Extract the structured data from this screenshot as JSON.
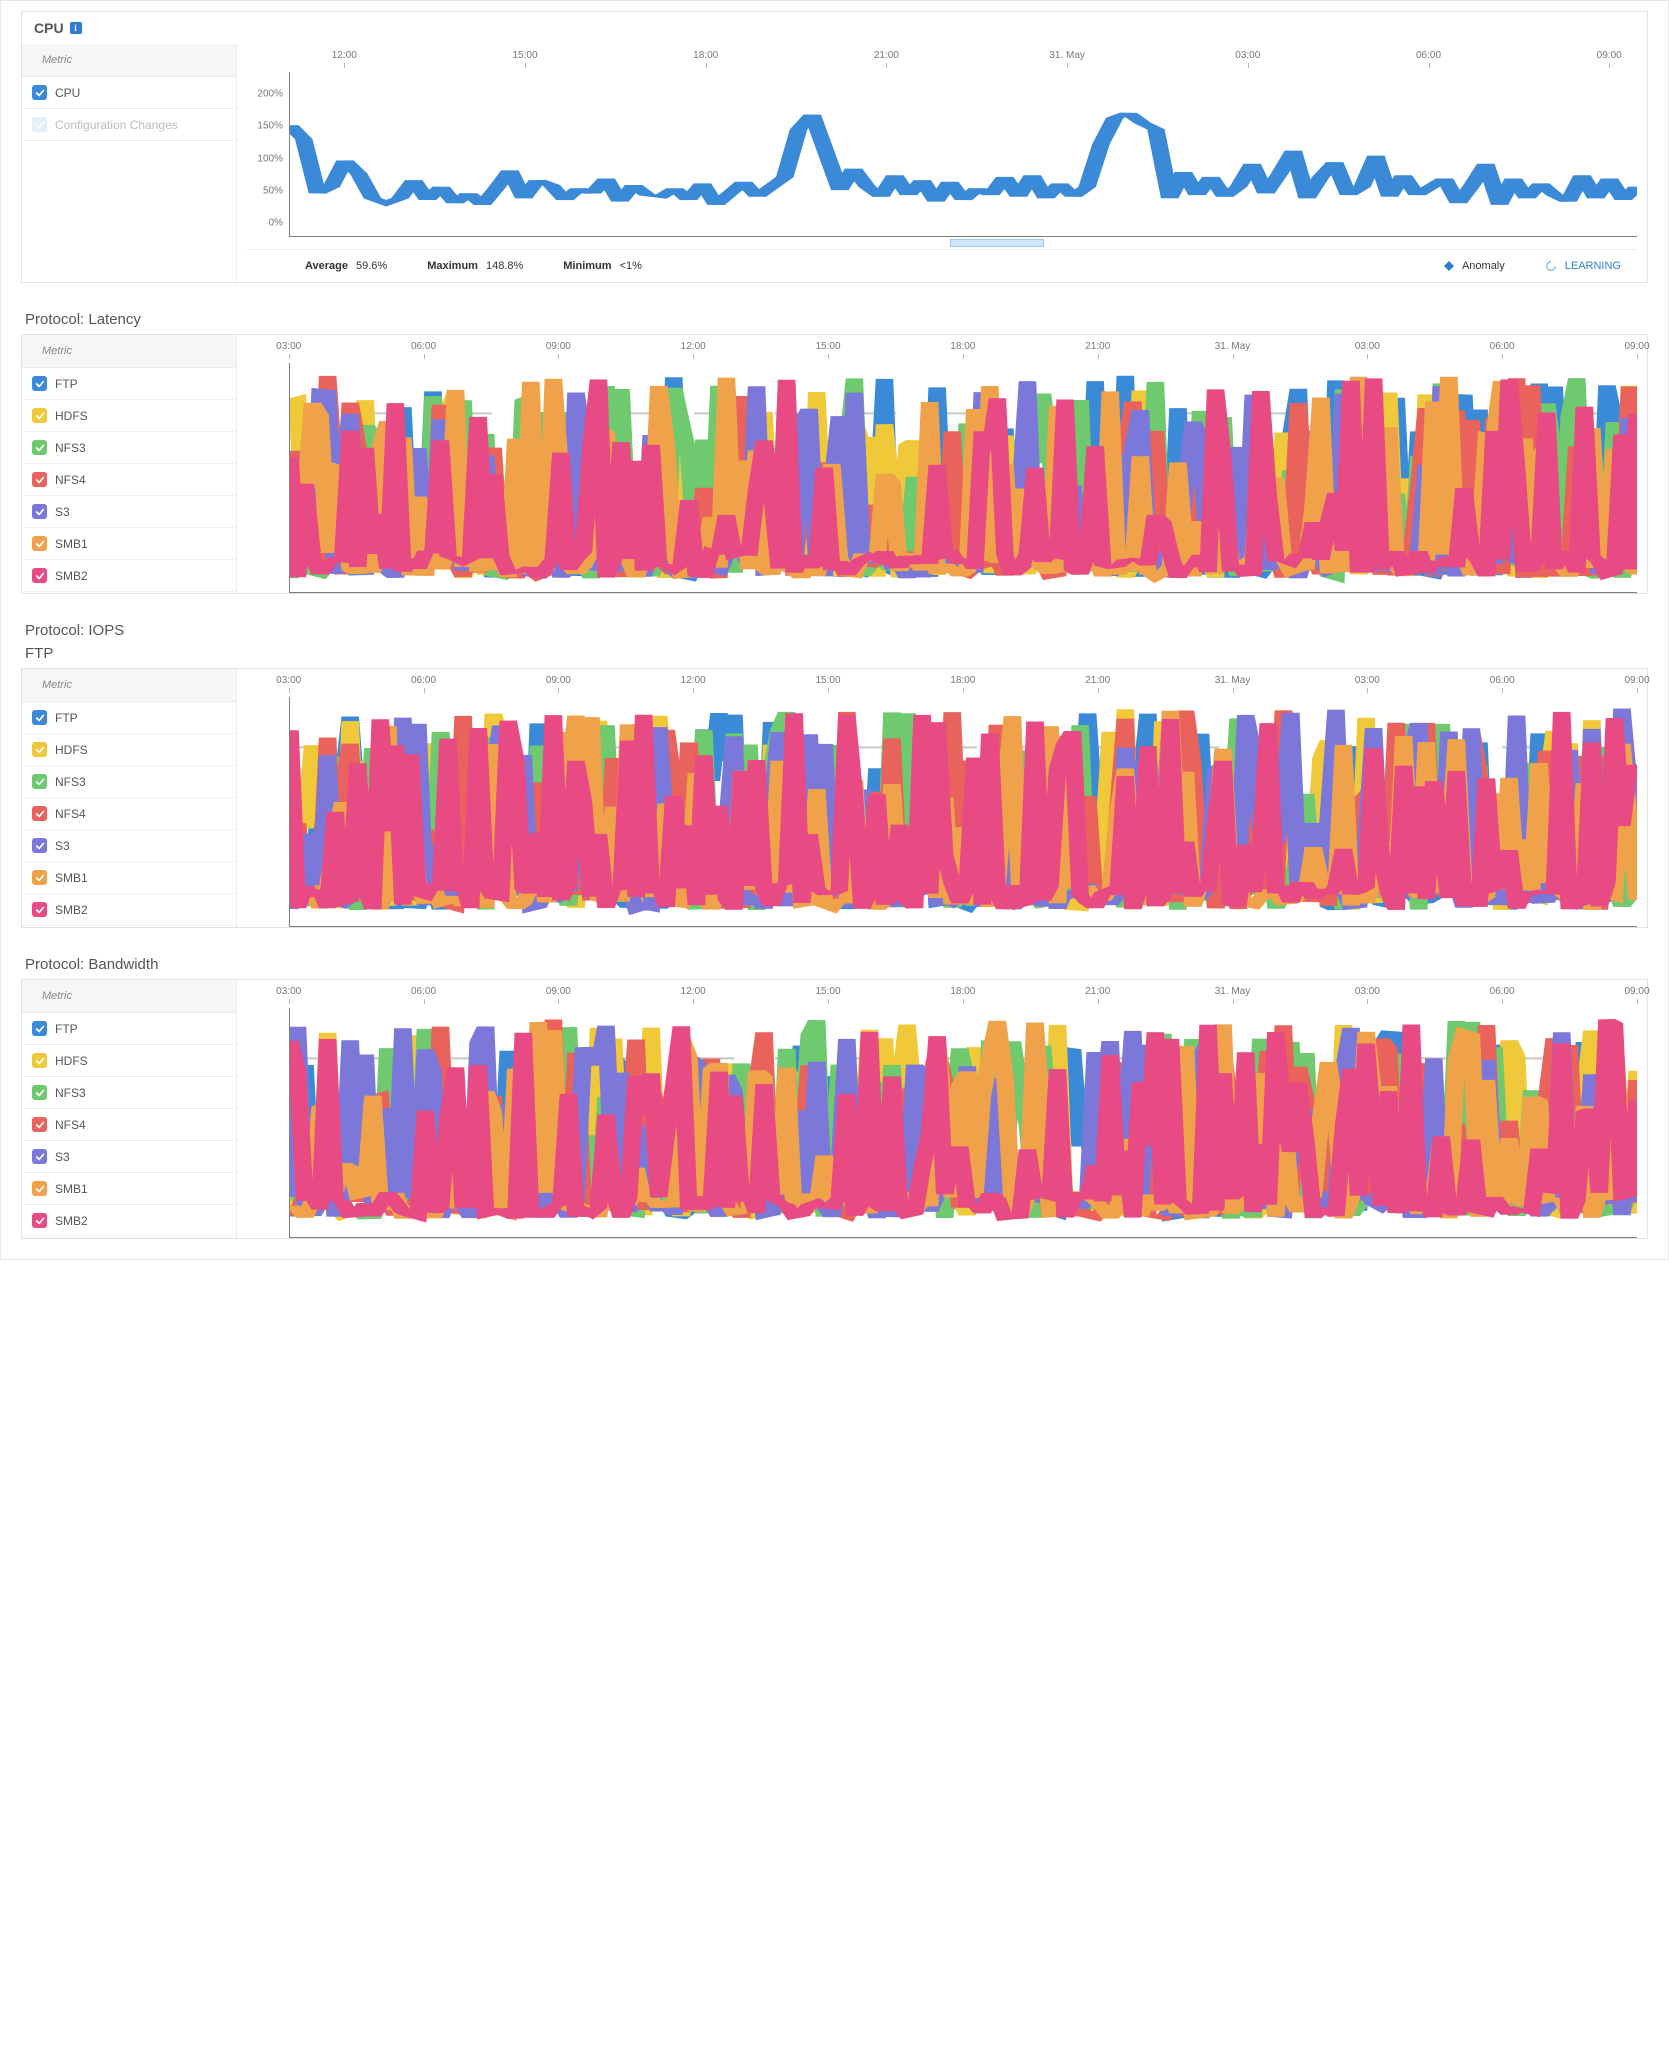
{
  "colors": {
    "blue": "#3b8ad8",
    "hdfs": "#f0c93a",
    "nfs3": "#6fc96f",
    "nfs4": "#e9635c",
    "s3": "#7b78d9",
    "smb1": "#f0a24a",
    "smb2": "#e84a84",
    "muted": "#e3eef8"
  },
  "legend_header": "Metric",
  "protocol_metrics": [
    {
      "key": "ftp",
      "label": "FTP",
      "color": "#3b8ad8"
    },
    {
      "key": "hdfs",
      "label": "HDFS",
      "color": "#f0c93a"
    },
    {
      "key": "nfs3",
      "label": "NFS3",
      "color": "#6fc96f"
    },
    {
      "key": "nfs4",
      "label": "NFS4",
      "color": "#e9635c"
    },
    {
      "key": "s3",
      "label": "S3",
      "color": "#7b78d9"
    },
    {
      "key": "smb1",
      "label": "SMB1",
      "color": "#f0a24a"
    },
    {
      "key": "smb2",
      "label": "SMB2",
      "color": "#e84a84"
    }
  ],
  "cpu_panel": {
    "title": "CPU",
    "info": "i",
    "metrics": [
      {
        "key": "cpu",
        "label": "CPU",
        "color": "#3b8ad8",
        "checked": true
      },
      {
        "key": "cfg",
        "label": "Configuration Changes",
        "color": "#e3eef8",
        "checked": false,
        "muted": true
      }
    ],
    "stats": {
      "avg_label": "Average",
      "avg": "59.6%",
      "max_label": "Maximum",
      "max": "148.8%",
      "min_label": "Minimum",
      "min": "<1%",
      "anomaly_label": "Anomaly",
      "learning": "LEARNING"
    }
  },
  "latency_panel": {
    "title": "Protocol: Latency"
  },
  "iops_panel": {
    "title": "Protocol: IOPS",
    "subtitle": "FTP"
  },
  "bandwidth_panel": {
    "title": "Protocol: Bandwidth"
  },
  "chart_data": [
    {
      "id": "cpu",
      "type": "line",
      "title": "CPU",
      "ylabel": "%",
      "ylim": [
        0,
        200
      ],
      "yticks": [
        0,
        50,
        100,
        150,
        200
      ],
      "yticklabels": [
        "0%",
        "50%",
        "100%",
        "150%",
        "200%"
      ],
      "xticklabels": [
        "12:00",
        "15:00",
        "18:00",
        "21:00",
        "31. May",
        "03:00",
        "06:00",
        "09:00"
      ],
      "x_positions": [
        7,
        20,
        33,
        46,
        59,
        72,
        85,
        98
      ],
      "range_selection": [
        49,
        56
      ],
      "series": [
        {
          "name": "CPU",
          "color": "#3b8ad8",
          "values": [
            135,
            118,
            52,
            60,
            92,
            76,
            46,
            40,
            46,
            68,
            44,
            60,
            40,
            52,
            38,
            58,
            80,
            46,
            68,
            62,
            44,
            58,
            52,
            70,
            42,
            62,
            50,
            48,
            58,
            44,
            64,
            38,
            52,
            66,
            48,
            60,
            72,
            130,
            148,
            102,
            56,
            82,
            60,
            48,
            74,
            50,
            68,
            42,
            66,
            44,
            58,
            50,
            72,
            48,
            74,
            46,
            64,
            48,
            60,
            112,
            144,
            150,
            138,
            130,
            46,
            78,
            50,
            72,
            48,
            60,
            88,
            52,
            76,
            104,
            46,
            72,
            90,
            50,
            60,
            98,
            48,
            74,
            50,
            60,
            70,
            40,
            62,
            88,
            38,
            70,
            46,
            64,
            50,
            42,
            74,
            46,
            70,
            44,
            60
          ]
        }
      ]
    },
    {
      "id": "latency",
      "type": "line",
      "title": "Protocol: Latency",
      "ylim": [
        0,
        100
      ],
      "xticklabels": [
        "03:00",
        "06:00",
        "09:00",
        "12:00",
        "15:00",
        "18:00",
        "21:00",
        "31. May",
        "03:00",
        "06:00",
        "09:00"
      ],
      "x_positions": [
        3,
        12.7,
        22.4,
        32.1,
        41.8,
        51.5,
        61.2,
        70.9,
        80.6,
        90.3,
        100
      ],
      "grid_y": [
        50,
        78
      ],
      "series": [
        {
          "name": "FTP",
          "color": "#3b8ad8"
        },
        {
          "name": "HDFS",
          "color": "#f0c93a"
        },
        {
          "name": "NFS3",
          "color": "#6fc96f"
        },
        {
          "name": "NFS4",
          "color": "#e9635c"
        },
        {
          "name": "S3",
          "color": "#7b78d9"
        },
        {
          "name": "SMB1",
          "color": "#f0a24a"
        },
        {
          "name": "SMB2",
          "color": "#e84a84"
        }
      ]
    },
    {
      "id": "iops",
      "type": "line",
      "title": "Protocol: IOPS – FTP",
      "ylim": [
        0,
        100
      ],
      "xticklabels": [
        "03:00",
        "06:00",
        "09:00",
        "12:00",
        "15:00",
        "18:00",
        "21:00",
        "31. May",
        "03:00",
        "06:00",
        "09:00"
      ],
      "x_positions": [
        3,
        12.7,
        22.4,
        32.1,
        41.8,
        51.5,
        61.2,
        70.9,
        80.6,
        90.3,
        100
      ],
      "grid_y": [
        50,
        78
      ],
      "series": [
        {
          "name": "FTP",
          "color": "#3b8ad8"
        },
        {
          "name": "HDFS",
          "color": "#f0c93a"
        },
        {
          "name": "NFS3",
          "color": "#6fc96f"
        },
        {
          "name": "NFS4",
          "color": "#e9635c"
        },
        {
          "name": "S3",
          "color": "#7b78d9"
        },
        {
          "name": "SMB1",
          "color": "#f0a24a"
        },
        {
          "name": "SMB2",
          "color": "#e84a84"
        }
      ]
    },
    {
      "id": "bandwidth",
      "type": "line",
      "title": "Protocol: Bandwidth",
      "ylim": [
        0,
        100
      ],
      "xticklabels": [
        "03:00",
        "06:00",
        "09:00",
        "12:00",
        "15:00",
        "18:00",
        "21:00",
        "31. May",
        "03:00",
        "06:00",
        "09:00"
      ],
      "x_positions": [
        3,
        12.7,
        22.4,
        32.1,
        41.8,
        51.5,
        61.2,
        70.9,
        80.6,
        90.3,
        100
      ],
      "grid_y": [
        50,
        78
      ],
      "series": [
        {
          "name": "FTP",
          "color": "#3b8ad8"
        },
        {
          "name": "HDFS",
          "color": "#f0c93a"
        },
        {
          "name": "NFS3",
          "color": "#6fc96f"
        },
        {
          "name": "NFS4",
          "color": "#e9635c"
        },
        {
          "name": "S3",
          "color": "#7b78d9"
        },
        {
          "name": "SMB1",
          "color": "#f0a24a"
        },
        {
          "name": "SMB2",
          "color": "#e84a84"
        }
      ]
    }
  ]
}
